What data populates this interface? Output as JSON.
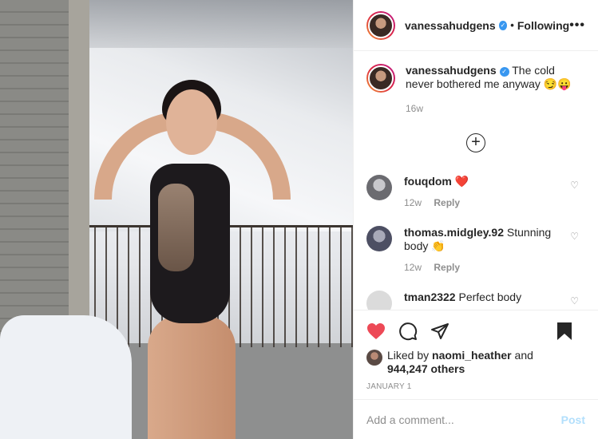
{
  "header": {
    "username": "vanessahudgens",
    "separator": "•",
    "following_label": "Following",
    "more_label": "•••"
  },
  "caption": {
    "username": "vanessahudgens",
    "text": "The cold never bothered me anyway 😏😛",
    "time": "16w"
  },
  "load_more_icon": "plus-circle-icon",
  "comments": [
    {
      "username": "fouqdom",
      "text": "❤️",
      "time": "12w",
      "reply_label": "Reply",
      "avatar_color": "#6b6b70"
    },
    {
      "username": "thomas.midgley.92",
      "text": "Stunning body 👏",
      "time": "12w",
      "reply_label": "Reply",
      "avatar_color": "#4d4f63"
    },
    {
      "username": "tman2322",
      "text": "Perfect body",
      "time": "",
      "reply_label": "",
      "avatar_color": "#dbdbdb"
    }
  ],
  "likes": {
    "prefix": "Liked by ",
    "by_user": "naomi_heather",
    "conjunction": " and",
    "count_text": "944,247 others"
  },
  "date": "JANUARY 1",
  "add_comment": {
    "placeholder": "Add a comment...",
    "post_label": "Post"
  },
  "colors": {
    "like_active": "#ed4956",
    "verified": "#3897f0",
    "post_disabled": "#b2dffc"
  }
}
